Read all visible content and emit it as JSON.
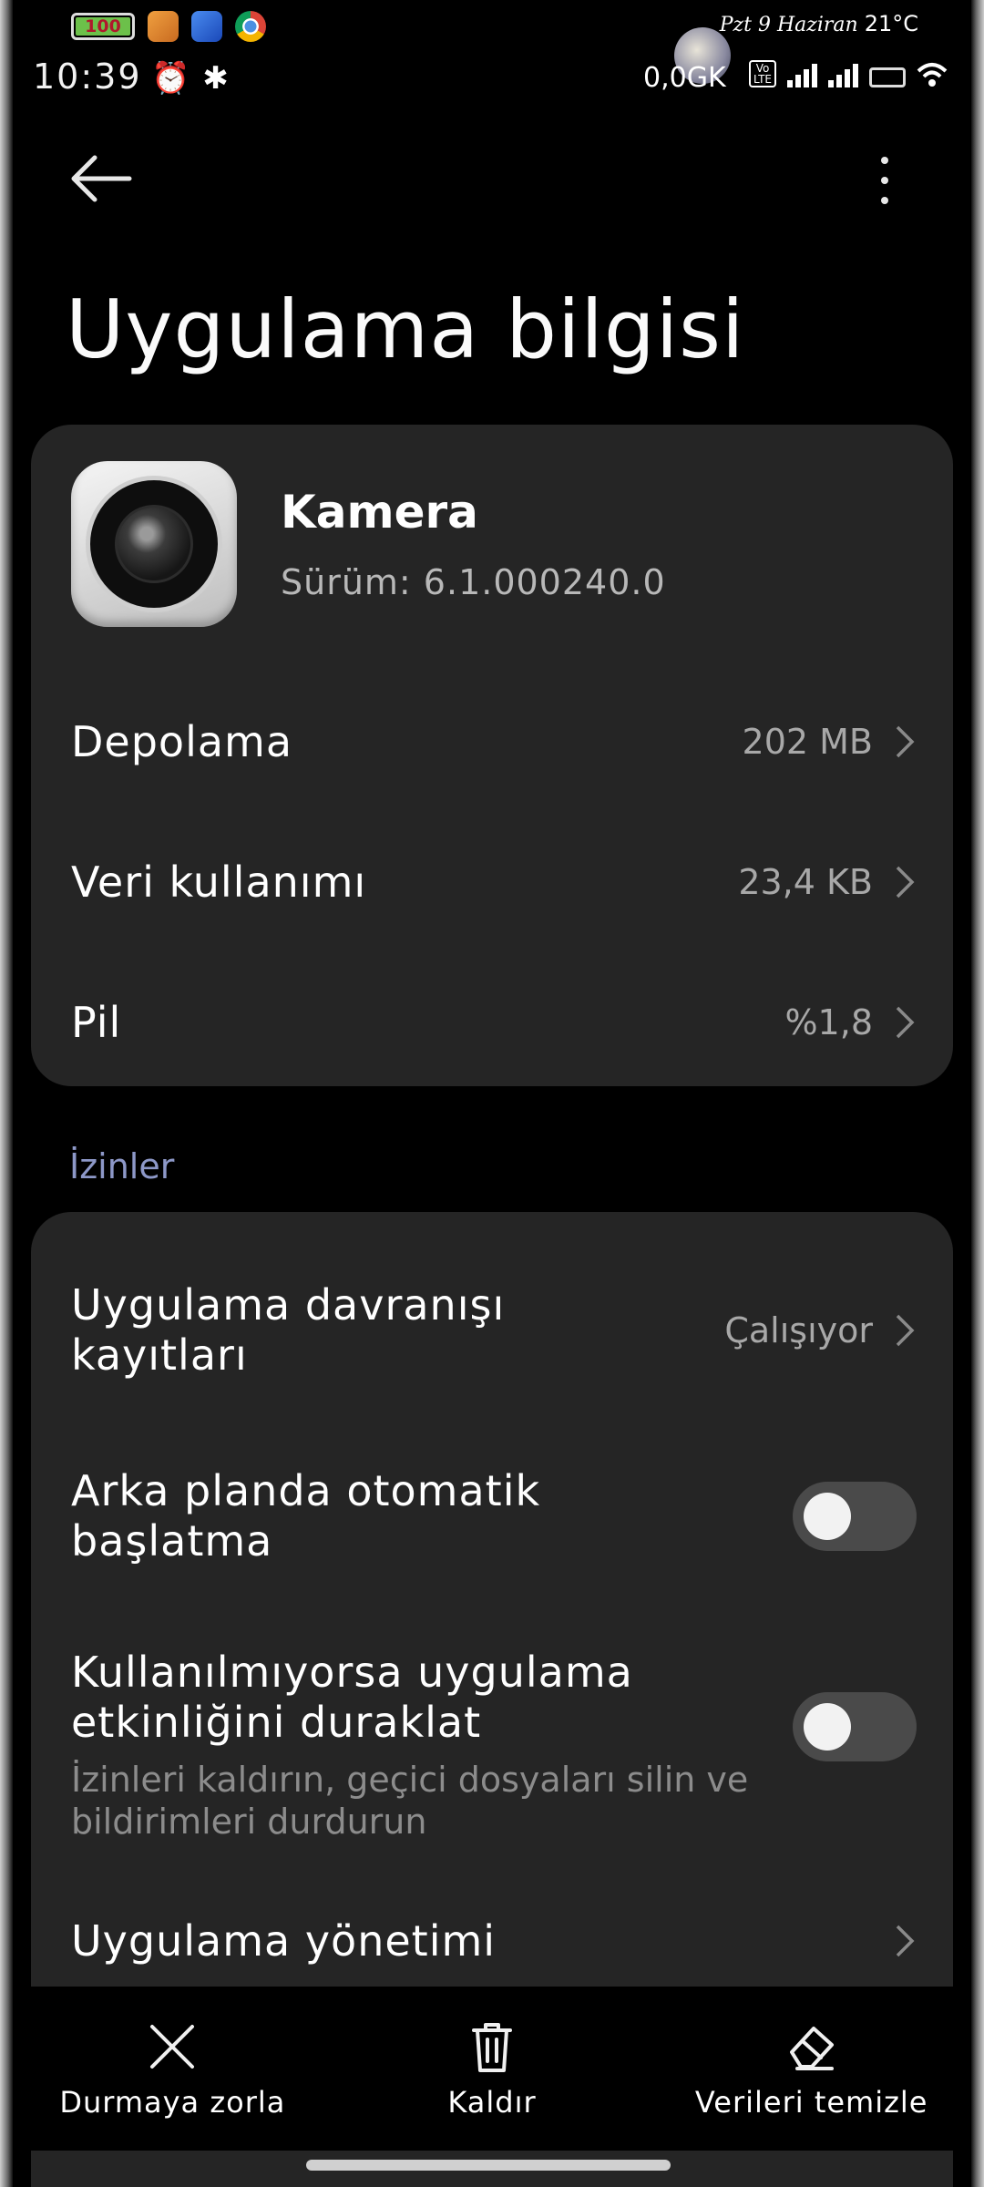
{
  "status_bar": {
    "time": "10:39",
    "notification_badge": "100",
    "weather_date": "Pzt 9 Haziran",
    "weather_temp": "21°C",
    "net_speed": "0,0GK"
  },
  "header": {
    "title": "Uygulama bilgisi"
  },
  "app": {
    "name": "Kamera",
    "version": "Sürüm: 6.1.000240.0"
  },
  "info_rows": [
    {
      "label": "Depolama",
      "value": "202 MB"
    },
    {
      "label": "Veri kullanımı",
      "value": "23,4 KB"
    },
    {
      "label": "Pil",
      "value": "%1,8"
    }
  ],
  "permissions": {
    "section_title": "İzinler",
    "behavior_logs": {
      "label": "Uygulama davranışı kayıtları",
      "value": "Çalışıyor"
    },
    "autostart": {
      "label": "Arka planda otomatik başlatma",
      "enabled": false
    },
    "pause_activity": {
      "label": "Kullanılmıyorsa uygulama etkinliğini duraklat",
      "description": "İzinleri kaldırın, geçici dosyaları silin ve bildirimleri durdurun",
      "enabled": false
    },
    "app_management": {
      "label": "Uygulama yönetimi"
    }
  },
  "actions": {
    "force_stop": "Durmaya zorla",
    "uninstall": "Kaldır",
    "clear_data": "Verileri temizle"
  },
  "colors": {
    "background": "#000000",
    "card": "#252525",
    "section_title": "#8d98c8",
    "secondary_text": "#a8a8a8",
    "toggle_off": "#4a4a4a"
  }
}
